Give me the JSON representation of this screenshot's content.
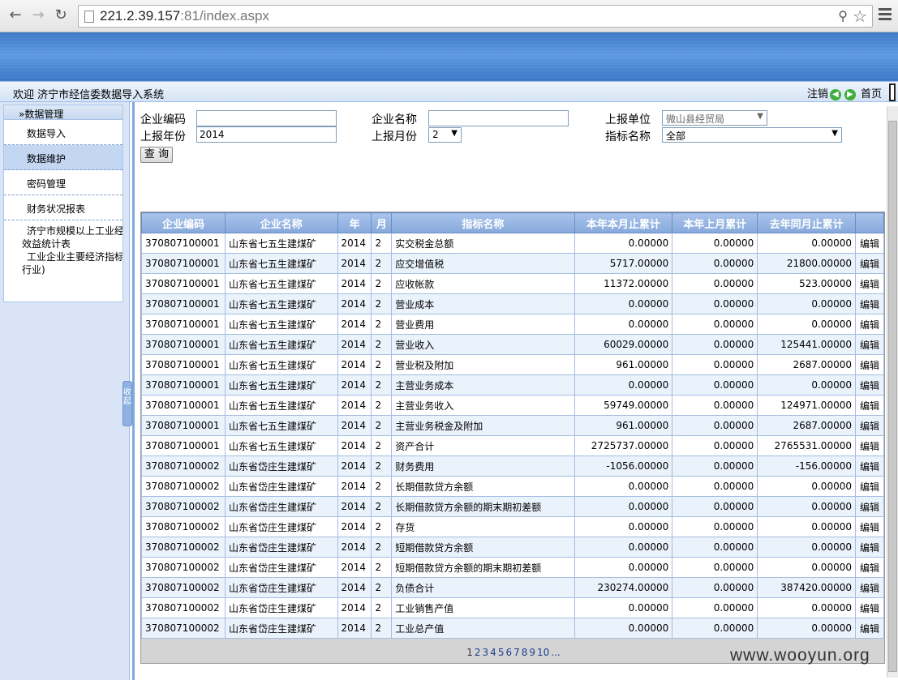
{
  "browser": {
    "url_host": "221.2.39.157",
    "url_port_path": ":81/index.aspx"
  },
  "header": {
    "welcome": "欢迎 济宁市经信委数据导入系统",
    "logout": "注销",
    "home": "首页"
  },
  "sidebar": {
    "title": "»数据管理",
    "items": [
      "数据导入",
      "数据维护",
      "密码管理",
      "财务状况报表"
    ],
    "multi_line_1": "济宁市规模以上工业经",
    "multi_line_2": "效益统计表",
    "multi_line_3": "工业企业主要经济指标",
    "multi_line_4": "行业)",
    "collapse_label": "收起"
  },
  "filters": {
    "company_code_label": "企业编码",
    "company_code_value": "",
    "company_name_label": "企业名称",
    "company_name_value": "",
    "report_unit_label": "上报单位",
    "report_unit_value": "微山县经贸局",
    "report_year_label": "上报年份",
    "report_year_value": "2014",
    "report_month_label": "上报月份",
    "report_month_value": "2",
    "indicator_label": "指标名称",
    "indicator_value": "全部",
    "query_button": "查 询"
  },
  "table": {
    "headers": [
      "企业编码",
      "企业名称",
      "年",
      "月",
      "指标名称",
      "本年本月止累计",
      "本年上月累计",
      "去年同月止累计",
      ""
    ],
    "edit_label": "编辑",
    "rows": [
      [
        "370807100001",
        "山东省七五生建煤矿",
        "2014",
        "2",
        "实交税金总额",
        "0.00000",
        "0.00000",
        "0.00000"
      ],
      [
        "370807100001",
        "山东省七五生建煤矿",
        "2014",
        "2",
        "应交增值税",
        "5717.00000",
        "0.00000",
        "21800.00000"
      ],
      [
        "370807100001",
        "山东省七五生建煤矿",
        "2014",
        "2",
        "应收帐款",
        "11372.00000",
        "0.00000",
        "523.00000"
      ],
      [
        "370807100001",
        "山东省七五生建煤矿",
        "2014",
        "2",
        "营业成本",
        "0.00000",
        "0.00000",
        "0.00000"
      ],
      [
        "370807100001",
        "山东省七五生建煤矿",
        "2014",
        "2",
        "营业费用",
        "0.00000",
        "0.00000",
        "0.00000"
      ],
      [
        "370807100001",
        "山东省七五生建煤矿",
        "2014",
        "2",
        "营业收入",
        "60029.00000",
        "0.00000",
        "125441.00000"
      ],
      [
        "370807100001",
        "山东省七五生建煤矿",
        "2014",
        "2",
        "营业税及附加",
        "961.00000",
        "0.00000",
        "2687.00000"
      ],
      [
        "370807100001",
        "山东省七五生建煤矿",
        "2014",
        "2",
        "主营业务成本",
        "0.00000",
        "0.00000",
        "0.00000"
      ],
      [
        "370807100001",
        "山东省七五生建煤矿",
        "2014",
        "2",
        "主营业务收入",
        "59749.00000",
        "0.00000",
        "124971.00000"
      ],
      [
        "370807100001",
        "山东省七五生建煤矿",
        "2014",
        "2",
        "主营业务税金及附加",
        "961.00000",
        "0.00000",
        "2687.00000"
      ],
      [
        "370807100001",
        "山东省七五生建煤矿",
        "2014",
        "2",
        "资产合计",
        "2725737.00000",
        "0.00000",
        "2765531.00000"
      ],
      [
        "370807100002",
        "山东省岱庄生建煤矿",
        "2014",
        "2",
        "财务费用",
        "-1056.00000",
        "0.00000",
        "-156.00000"
      ],
      [
        "370807100002",
        "山东省岱庄生建煤矿",
        "2014",
        "2",
        "长期借款贷方余额",
        "0.00000",
        "0.00000",
        "0.00000"
      ],
      [
        "370807100002",
        "山东省岱庄生建煤矿",
        "2014",
        "2",
        "长期借款贷方余额的期末期初差额",
        "0.00000",
        "0.00000",
        "0.00000"
      ],
      [
        "370807100002",
        "山东省岱庄生建煤矿",
        "2014",
        "2",
        "存货",
        "0.00000",
        "0.00000",
        "0.00000"
      ],
      [
        "370807100002",
        "山东省岱庄生建煤矿",
        "2014",
        "2",
        "短期借款贷方余额",
        "0.00000",
        "0.00000",
        "0.00000"
      ],
      [
        "370807100002",
        "山东省岱庄生建煤矿",
        "2014",
        "2",
        "短期借款贷方余额的期末期初差额",
        "0.00000",
        "0.00000",
        "0.00000"
      ],
      [
        "370807100002",
        "山东省岱庄生建煤矿",
        "2014",
        "2",
        "负债合计",
        "230274.00000",
        "0.00000",
        "387420.00000"
      ],
      [
        "370807100002",
        "山东省岱庄生建煤矿",
        "2014",
        "2",
        "工业销售产值",
        "0.00000",
        "0.00000",
        "0.00000"
      ],
      [
        "370807100002",
        "山东省岱庄生建煤矿",
        "2014",
        "2",
        "工业总产值",
        "0.00000",
        "0.00000",
        "0.00000"
      ]
    ]
  },
  "pager": {
    "pages": [
      "1",
      "2",
      "3",
      "4",
      "5",
      "6",
      "7",
      "8",
      "9",
      "10",
      "..."
    ],
    "current": "1"
  },
  "watermark": "www.wooyun.org"
}
